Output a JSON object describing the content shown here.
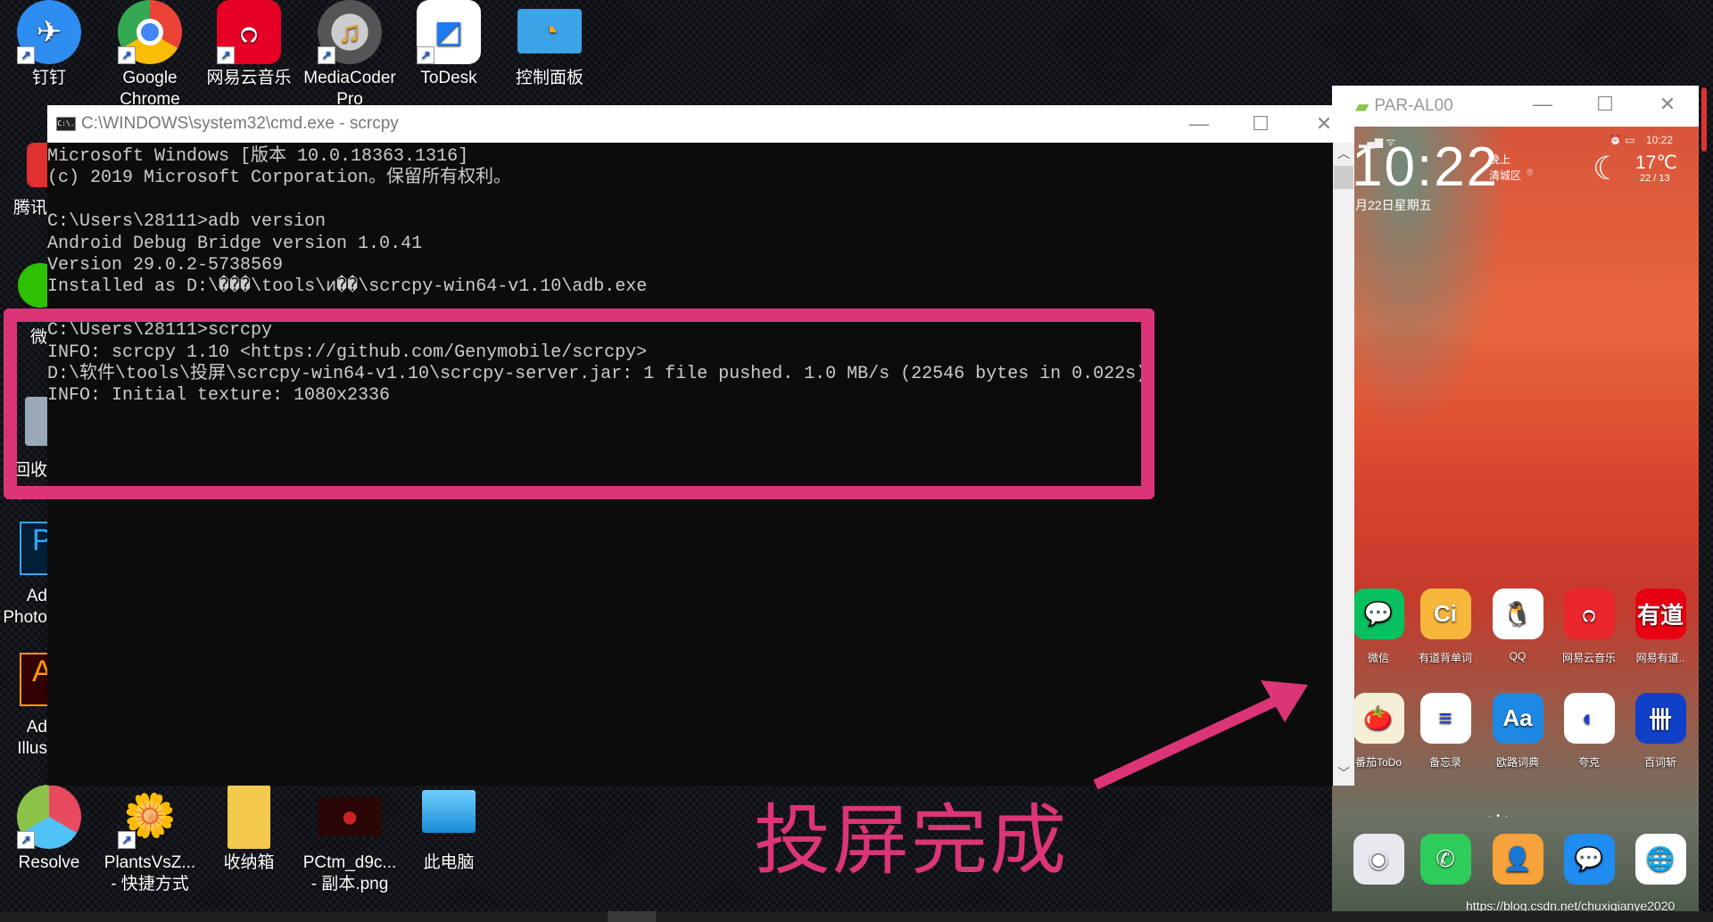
{
  "desktop": {
    "top_icons": [
      {
        "label": "钉钉",
        "icon": "dingtalk-icon",
        "color": "#2f8cf0"
      },
      {
        "label": "Google Chrome",
        "icon": "chrome-icon",
        "color": "#4285f4"
      },
      {
        "label": "网易云音乐",
        "icon": "netease-music-icon",
        "color": "#e60026"
      },
      {
        "label": "MediaCoder Pro",
        "icon": "mediacoder-icon",
        "color": "#888888"
      },
      {
        "label": "ToDesk",
        "icon": "todesk-icon",
        "color": "#ffffff"
      },
      {
        "label": "控制面板",
        "icon": "control-panel-icon",
        "color": "#3ba3e8"
      }
    ],
    "left_icons": [
      "腾讯",
      "微",
      "回收",
      "Ad",
      "Photo",
      "Ad",
      "Illus"
    ],
    "bottom_icons": [
      {
        "label": "Resolve",
        "icon": "davinci-resolve-icon"
      },
      {
        "label": "PlantsVsZ... - 快捷方式",
        "icon": "plants-vs-zombies-icon"
      },
      {
        "label": "收纳箱",
        "icon": "folder-icon"
      },
      {
        "label": "PCtm_d9c... - 副本.png",
        "icon": "image-file-icon"
      },
      {
        "label": "此电脑",
        "icon": "this-pc-icon"
      }
    ]
  },
  "cmd": {
    "title": "C:\\WINDOWS\\system32\\cmd.exe - scrcpy",
    "icon_text": "C:\\.",
    "lines": [
      "Microsoft Windows [版本 10.0.18363.1316]",
      "(c) 2019 Microsoft Corporation。保留所有权利。",
      "",
      "C:\\Users\\28111>adb version",
      "Android Debug Bridge version 1.0.41",
      "Version 29.0.2-5738569",
      "Installed as D:\\���\\tools\\и��\\scrcpy-win64-v1.10\\adb.exe",
      "",
      "C:\\Users\\28111>scrcpy",
      "INFO: scrcpy 1.10 <https://github.com/Genymobile/scrcpy>",
      "D:\\软件\\tools\\投屏\\scrcpy-win64-v1.10\\scrcpy-server.jar: 1 file pushed. 1.0 MB/s (22546 bytes in 0.022s)",
      "INFO: Initial texture: 1080x2336"
    ]
  },
  "phone": {
    "title": "PAR-AL00",
    "status_time": "10:22",
    "clock": "10:22",
    "period": "晚上",
    "district": "清城区",
    "date": "月22日星期五",
    "temp": "17℃",
    "temp_range": "22 / 13",
    "apps": [
      {
        "label": "微信",
        "glyph": "💬",
        "bg": "#07c160"
      },
      {
        "label": "有道背单词",
        "glyph": "Ci",
        "bg": "#f6b73c"
      },
      {
        "label": "QQ",
        "glyph": "🐧",
        "bg": "#ffffff"
      },
      {
        "label": "网易云音乐",
        "glyph": "೧",
        "bg": "#e8262b"
      },
      {
        "label": "网易有道..",
        "glyph": "有道",
        "bg": "#e60012"
      },
      {
        "label": "番茄ToDo",
        "glyph": "🍅",
        "bg": "#f5efd6"
      },
      {
        "label": "备忘录",
        "glyph": "≡",
        "bg": "#ffffff"
      },
      {
        "label": "欧路词典",
        "glyph": "Aa",
        "bg": "#1e88e5"
      },
      {
        "label": "夸克",
        "glyph": "◐",
        "bg": "#ffffff"
      },
      {
        "label": "百词斩",
        "glyph": "卌",
        "bg": "#1040c8"
      }
    ],
    "dock": [
      {
        "icon": "camera-icon",
        "glyph": "◉",
        "bg": "#e8e8ef"
      },
      {
        "icon": "phone-icon",
        "glyph": "✆",
        "bg": "#2ecc5a"
      },
      {
        "icon": "contacts-icon",
        "glyph": "👤",
        "bg": "#f7a23a"
      },
      {
        "icon": "messages-icon",
        "glyph": "💬",
        "bg": "#1e8cf0"
      },
      {
        "icon": "browser-icon",
        "glyph": "🌐",
        "bg": "#ffffff"
      }
    ]
  },
  "annotation": {
    "text": "投屏完成",
    "color": "#dc3577"
  },
  "watermark": "https://blog.csdn.net/chuxiqianye2020"
}
